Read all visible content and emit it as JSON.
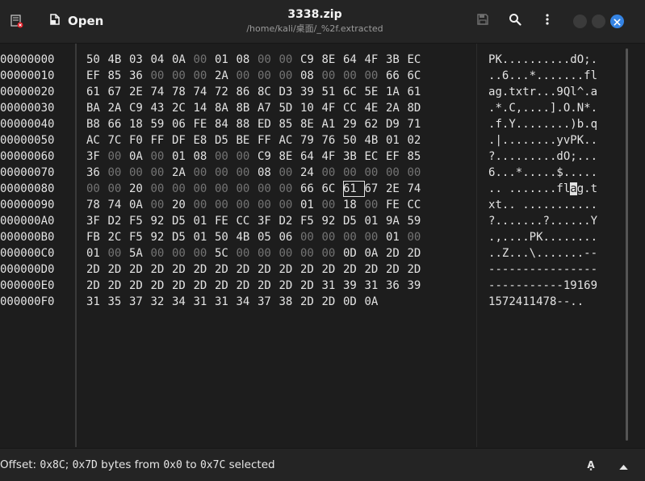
{
  "header": {
    "open_label": "Open",
    "title": "3338.zip",
    "subtitle": "/home/kali/桌面/_%2f.extracted"
  },
  "icons": {
    "app": "app-icon",
    "open": "open-file-icon",
    "save": "save-icon",
    "search": "search-icon",
    "menu": "kebab-menu-icon",
    "minimize": "window-minimize",
    "maximize": "window-maximize",
    "close": "close-icon",
    "format": "text-format-icon",
    "expand": "chevron-up-icon"
  },
  "colors": {
    "background": "#1d1d1d",
    "header": "#242424",
    "text": "#e3e3e3",
    "dim_zero_bytes": "#747474",
    "close_button": "#3584e4"
  },
  "hex": {
    "cursor": {
      "row": 8,
      "byte": 12
    },
    "rows": [
      {
        "offset": "00000000",
        "bytes": "50 4B 03 04 0A 00 01 08 00 00 C9 8E 64 4F 3B EC",
        "ascii": "PK..........dO;."
      },
      {
        "offset": "00000010",
        "bytes": "EF 85 36 00 00 00 2A 00 00 00 08 00 00 00 66 6C",
        "ascii": "..6...*.......fl"
      },
      {
        "offset": "00000020",
        "bytes": "61 67 2E 74 78 74 72 86 8C D3 39 51 6C 5E 1A 61",
        "ascii": "ag.txtr...9Ql^.a"
      },
      {
        "offset": "00000030",
        "bytes": "BA 2A C9 43 2C 14 8A 8B A7 5D 10 4F CC 4E 2A 8D",
        "ascii": ".*.C,....].O.N*."
      },
      {
        "offset": "00000040",
        "bytes": "B8 66 18 59 06 FE 84 88 ED 85 8E A1 29 62 D9 71",
        "ascii": ".f.Y........)b.q"
      },
      {
        "offset": "00000050",
        "bytes": "AC 7C F0 FF DF E8 D5 BE FF AC 79 76 50 4B 01 02",
        "ascii": ".|........yvPK.."
      },
      {
        "offset": "00000060",
        "bytes": "3F 00 0A 00 01 08 00 00 C9 8E 64 4F 3B EC EF 85",
        "ascii": "?.........dO;..."
      },
      {
        "offset": "00000070",
        "bytes": "36 00 00 00 2A 00 00 00 08 00 24 00 00 00 00 00",
        "ascii": "6...*.....$....."
      },
      {
        "offset": "00000080",
        "bytes": "00 00 20 00 00 00 00 00 00 00 66 6C 61 67 2E 74",
        "ascii": ".. .......flag.t"
      },
      {
        "offset": "00000090",
        "bytes": "78 74 0A 00 20 00 00 00 00 00 01 00 18 00 FE CC",
        "ascii": "xt.. ..........."
      },
      {
        "offset": "000000A0",
        "bytes": "3F D2 F5 92 D5 01 FE CC 3F D2 F5 92 D5 01 9A 59",
        "ascii": "?.......?......Y"
      },
      {
        "offset": "000000B0",
        "bytes": "FB 2C F5 92 D5 01 50 4B 05 06 00 00 00 00 01 00",
        "ascii": ".,....PK........"
      },
      {
        "offset": "000000C0",
        "bytes": "01 00 5A 00 00 00 5C 00 00 00 00 00 0D 0A 2D 2D",
        "ascii": "..Z...\\.......--"
      },
      {
        "offset": "000000D0",
        "bytes": "2D 2D 2D 2D 2D 2D 2D 2D 2D 2D 2D 2D 2D 2D 2D 2D",
        "ascii": "----------------"
      },
      {
        "offset": "000000E0",
        "bytes": "2D 2D 2D 2D 2D 2D 2D 2D 2D 2D 2D 31 39 31 36 39",
        "ascii": "-----------19169"
      },
      {
        "offset": "000000F0",
        "bytes": "31 35 37 32 34 31 31 34 37 38 2D 2D 0D 0A",
        "ascii": "1572411478--.."
      }
    ]
  },
  "status": {
    "prefix": "Offset: ",
    "offset_value": "0x8C",
    "sep": "; ",
    "count_value": "0x7D",
    "middle": " bytes from ",
    "from_value": "0x0",
    "to_word": " to ",
    "to_value": "0x7C",
    "suffix": " selected",
    "format_icon_text": "A͓"
  }
}
